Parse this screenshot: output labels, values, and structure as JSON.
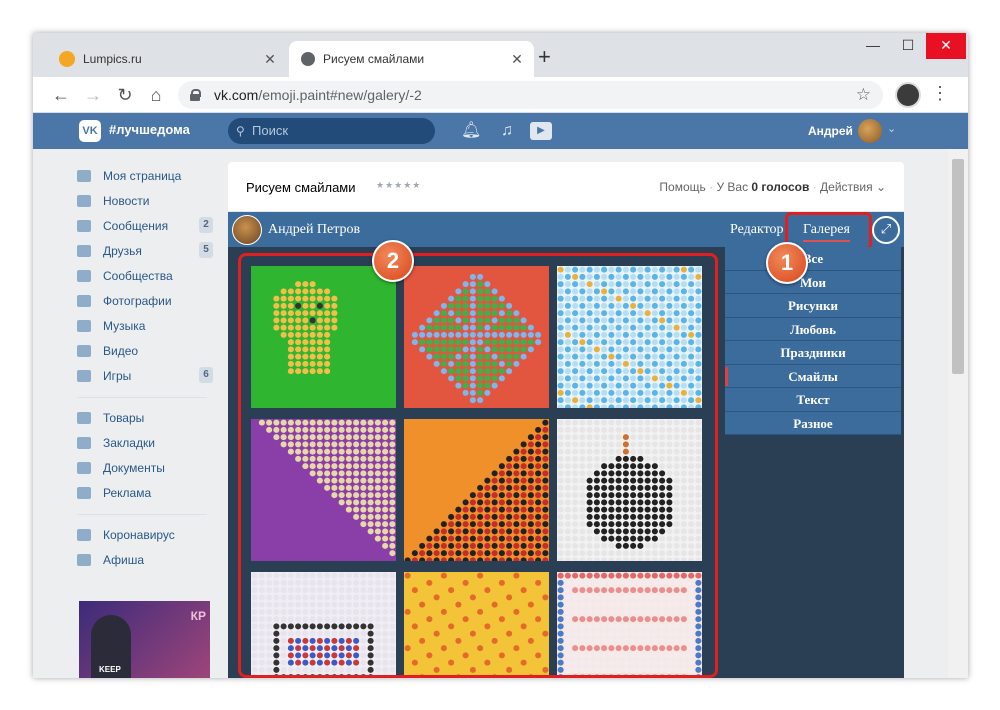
{
  "browser": {
    "tabs": [
      {
        "title": "Lumpics.ru",
        "active": false
      },
      {
        "title": "Рисуем смайлами",
        "active": true
      }
    ],
    "new_tab": "+",
    "url_domain": "vk.com",
    "url_path": "/emoji.paint#new/galery/-2",
    "controls": {
      "minimize": "—",
      "maximize": "☐",
      "close": "✕"
    }
  },
  "vk_header": {
    "logo": "VK",
    "tag": "#лучшедома",
    "search_placeholder": "Поиск",
    "user_name": "Андрей"
  },
  "left_menu": {
    "group1": [
      {
        "label": "Моя страница",
        "count": ""
      },
      {
        "label": "Новости",
        "count": ""
      },
      {
        "label": "Сообщения",
        "count": "2"
      },
      {
        "label": "Друзья",
        "count": "5"
      },
      {
        "label": "Сообщества",
        "count": ""
      },
      {
        "label": "Фотографии",
        "count": ""
      },
      {
        "label": "Музыка",
        "count": ""
      },
      {
        "label": "Видео",
        "count": ""
      },
      {
        "label": "Игры",
        "count": "6"
      }
    ],
    "group2": [
      {
        "label": "Товары"
      },
      {
        "label": "Закладки"
      },
      {
        "label": "Документы"
      },
      {
        "label": "Реклама"
      }
    ],
    "group3": [
      {
        "label": "Коронавирус"
      },
      {
        "label": "Афиша"
      }
    ],
    "promo": {
      "corner_text": "КР",
      "shirt_text": "KEEP"
    }
  },
  "app": {
    "title": "Рисуем смайлами",
    "stars": "★★★★★",
    "help": "Помощь",
    "votes_prefix": "У Вас",
    "votes_value": "0 голосов",
    "actions": "Действия",
    "author": "Андрей Петров",
    "tab_editor": "Редактор",
    "tab_gallery": "Галерея",
    "categories": [
      "Все",
      "Мои",
      "Рисунки",
      "Любовь",
      "Праздники",
      "Смайлы",
      "Текст",
      "Разное"
    ],
    "selected_category": "Смайлы"
  },
  "annotations": {
    "badge1": "1",
    "badge2": "2"
  },
  "tiles": [
    {
      "kind": "chick",
      "bg": "#2fb52f"
    },
    {
      "kind": "diamond",
      "bg": "#e2553f"
    },
    {
      "kind": "drops",
      "bg": "#e8f4fa"
    },
    {
      "kind": "diag-purple",
      "bg": "#8a3fa8"
    },
    {
      "kind": "diag-orange",
      "bg": "#f0902a"
    },
    {
      "kind": "bomb",
      "bg": "#f2f2f2"
    },
    {
      "kind": "heart",
      "bg": "#f0eef4"
    },
    {
      "kind": "yellow",
      "bg": "#f3c338"
    },
    {
      "kind": "frame",
      "bg": "#f7e8e8"
    }
  ]
}
